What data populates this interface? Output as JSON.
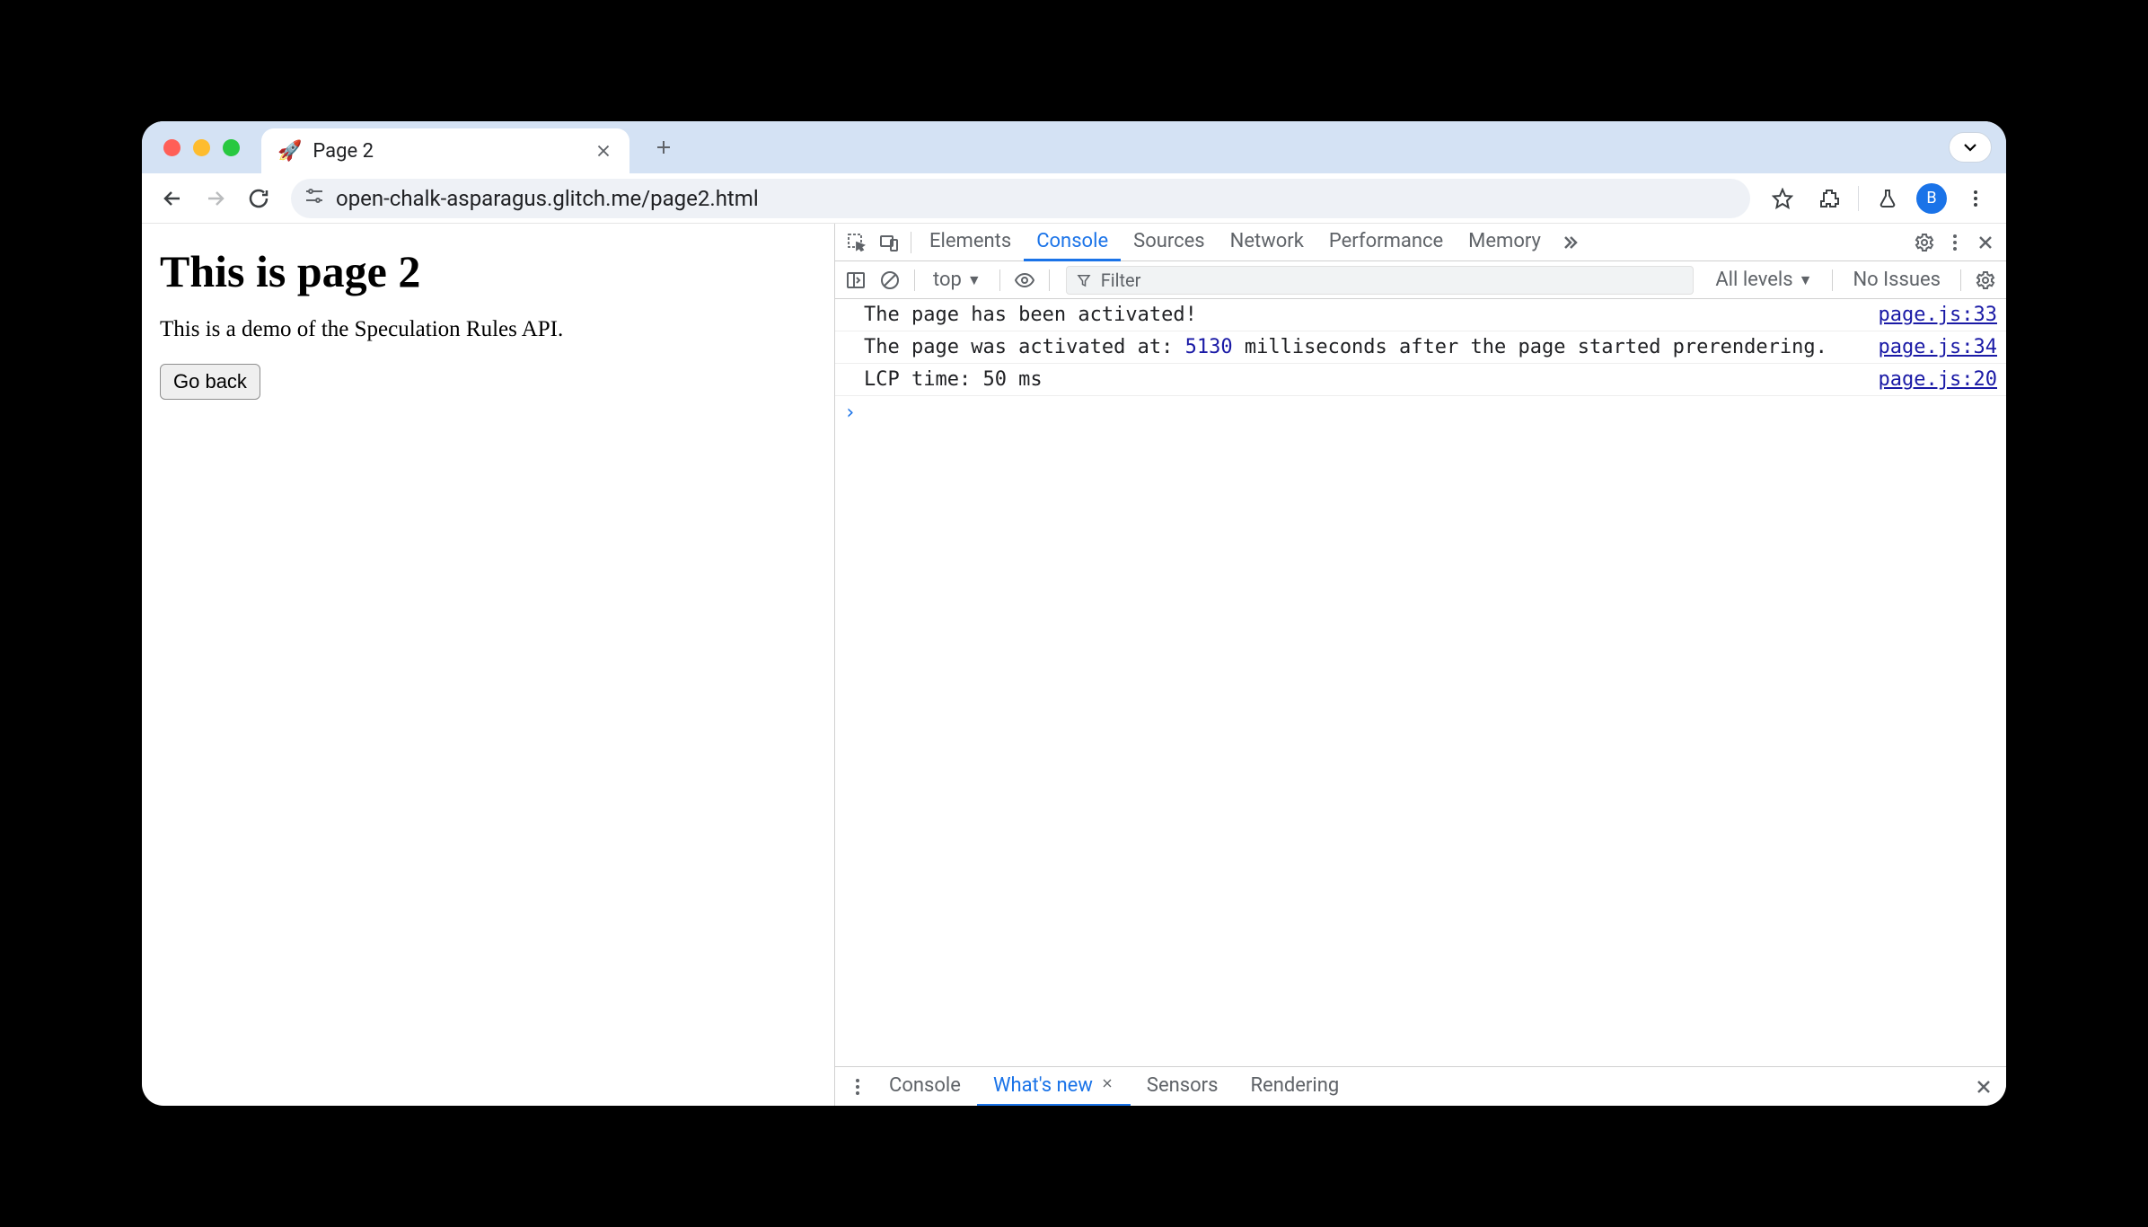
{
  "window": {
    "tab_title": "Page 2",
    "favicon": "🚀",
    "url": "open-chalk-asparagus.glitch.me/page2.html",
    "avatar_letter": "B"
  },
  "page": {
    "heading": "This is page 2",
    "paragraph": "This is a demo of the Speculation Rules API.",
    "button_label": "Go back"
  },
  "devtools": {
    "tabs": [
      "Elements",
      "Console",
      "Sources",
      "Network",
      "Performance",
      "Memory"
    ],
    "active_tab": "Console",
    "console_toolbar": {
      "context": "top",
      "filter_placeholder": "Filter",
      "levels_label": "All levels",
      "issues_label": "No Issues"
    },
    "console_rows": [
      {
        "msg_pre": "The page has been activated!",
        "num": "",
        "msg_post": "",
        "src": "page.js:33"
      },
      {
        "msg_pre": "The page was activated at: ",
        "num": "5130",
        "msg_post": "  milliseconds after the page started prerendering.",
        "src": "page.js:34"
      },
      {
        "msg_pre": "LCP time: 50 ms",
        "num": "",
        "msg_post": "",
        "src": "page.js:20"
      }
    ],
    "drawer": {
      "tabs": [
        "Console",
        "What's new",
        "Sensors",
        "Rendering"
      ],
      "active": "What's new"
    }
  }
}
